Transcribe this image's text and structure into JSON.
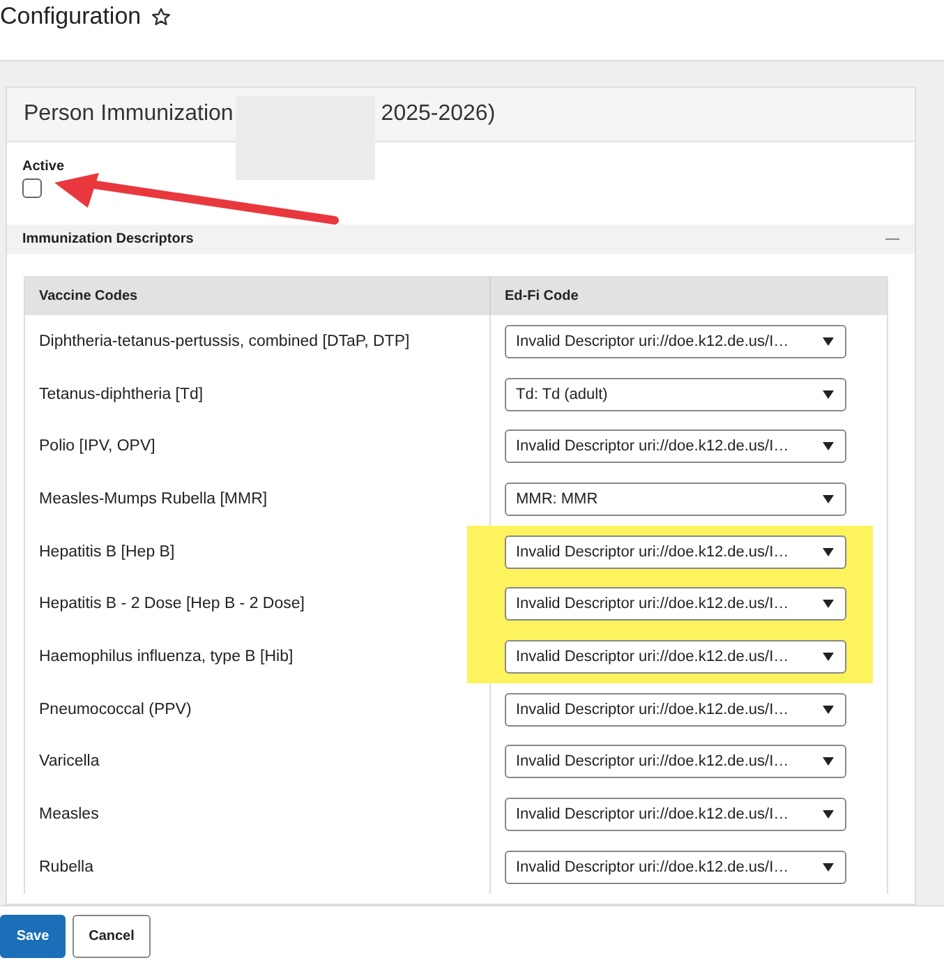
{
  "page": {
    "title": "Configuration",
    "favorite": false
  },
  "card": {
    "title_start": "Person Immunization",
    "title_end": "2025-2026)",
    "redacted": true
  },
  "active": {
    "label": "Active",
    "checked": false
  },
  "section": {
    "title": "Immunization Descriptors",
    "collapse": "—"
  },
  "table": {
    "columns": [
      "Vaccine Codes",
      "Ed-Fi Code"
    ],
    "rows": [
      {
        "vaccine": "Diphtheria-tetanus-pertussis, combined [DTaP, DTP]",
        "code": "Invalid Descriptor uri://doe.k12.de.us/I…",
        "highlighted": false
      },
      {
        "vaccine": "Tetanus-diphtheria [Td]",
        "code": "Td: Td (adult)",
        "highlighted": false
      },
      {
        "vaccine": "Polio [IPV, OPV]",
        "code": "Invalid Descriptor uri://doe.k12.de.us/I…",
        "highlighted": false
      },
      {
        "vaccine": "Measles-Mumps Rubella [MMR]",
        "code": "MMR: MMR",
        "highlighted": false
      },
      {
        "vaccine": "Hepatitis B [Hep B]",
        "code": "Invalid Descriptor uri://doe.k12.de.us/I…",
        "highlighted": true
      },
      {
        "vaccine": "Hepatitis B - 2 Dose [Hep B - 2 Dose]",
        "code": "Invalid Descriptor uri://doe.k12.de.us/I…",
        "highlighted": true
      },
      {
        "vaccine": "Haemophilus influenza, type B [Hib]",
        "code": "Invalid Descriptor uri://doe.k12.de.us/I…",
        "highlighted": true
      },
      {
        "vaccine": "Pneumococcal (PPV)",
        "code": "Invalid Descriptor uri://doe.k12.de.us/I…",
        "highlighted": false
      },
      {
        "vaccine": "Varicella",
        "code": "Invalid Descriptor uri://doe.k12.de.us/I…",
        "highlighted": false
      },
      {
        "vaccine": "Measles",
        "code": "Invalid Descriptor uri://doe.k12.de.us/I…",
        "highlighted": false
      },
      {
        "vaccine": "Rubella",
        "code": "Invalid Descriptor uri://doe.k12.de.us/I…",
        "highlighted": false
      }
    ]
  },
  "buttons": [
    {
      "label": "Save",
      "kind": "primary"
    },
    {
      "label": "Cancel",
      "kind": "secondary"
    }
  ]
}
